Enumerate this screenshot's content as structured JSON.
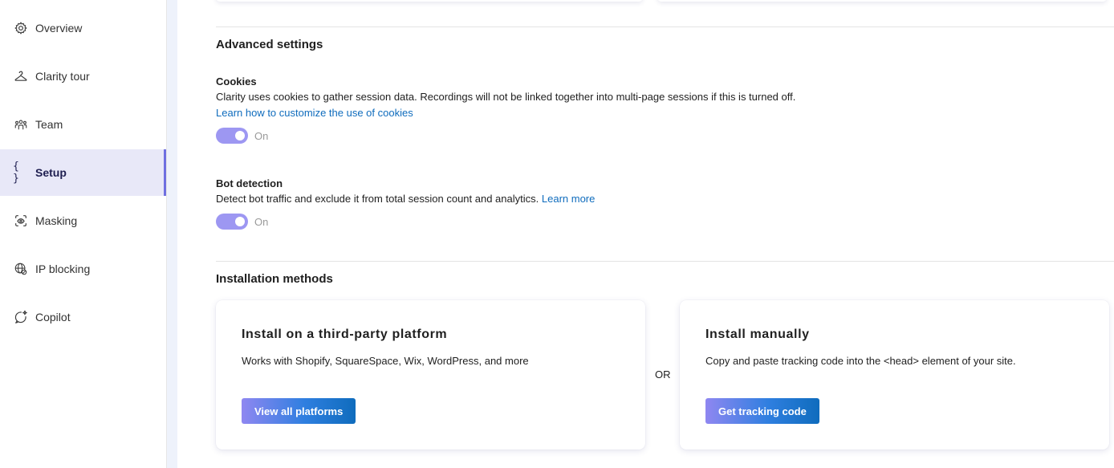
{
  "sidebar": {
    "items": [
      {
        "label": "Overview",
        "icon": "gear-icon"
      },
      {
        "label": "Clarity tour",
        "icon": "hanger-icon"
      },
      {
        "label": "Team",
        "icon": "people-icon"
      },
      {
        "label": "Setup",
        "icon": "braces-icon",
        "active": true
      },
      {
        "label": "Masking",
        "icon": "eye-mask-icon"
      },
      {
        "label": "IP blocking",
        "icon": "globe-block-icon"
      },
      {
        "label": "Copilot",
        "icon": "sparkle-chat-icon"
      }
    ],
    "setup_glyph": "{ }"
  },
  "advanced": {
    "title": "Advanced settings",
    "cookies": {
      "title": "Cookies",
      "description": "Clarity uses cookies to gather session data. Recordings will not be linked together into multi-page sessions if this is turned off.",
      "link": "Learn how to customize the use of cookies",
      "toggle_label": "On",
      "enabled": true
    },
    "bot": {
      "title": "Bot detection",
      "description": "Detect bot traffic and exclude it from total session count and analytics.",
      "link": "Learn more",
      "toggle_label": "On",
      "enabled": true
    }
  },
  "installation": {
    "title": "Installation methods",
    "or_label": "OR",
    "third_party": {
      "title": "Install on a third-party platform",
      "description": "Works with Shopify, SquareSpace, Wix, WordPress, and more",
      "button": "View all platforms"
    },
    "manual": {
      "title": "Install manually",
      "description": "Copy and paste tracking code into the <head> element of your site.",
      "button": "Get tracking code"
    }
  },
  "colors": {
    "accent": "#6f6fe0",
    "toggle": "#9d97f2",
    "link": "#0f6cbd",
    "active_bg": "#e8e8f8"
  }
}
